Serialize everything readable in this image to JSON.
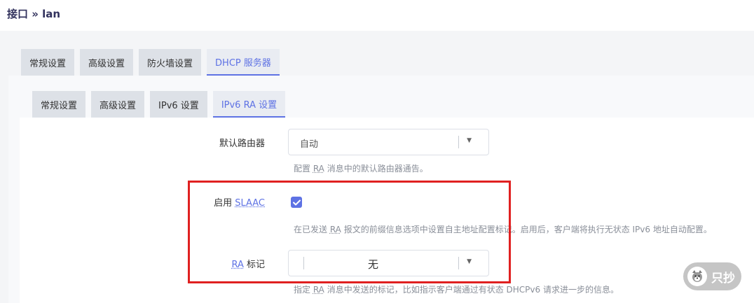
{
  "breadcrumb": "接口 » lan",
  "outer_tabs": [
    {
      "label": "常规设置",
      "active": false
    },
    {
      "label": "高级设置",
      "active": false
    },
    {
      "label": "防火墙设置",
      "active": false
    },
    {
      "label": "DHCP 服务器",
      "active": true
    }
  ],
  "inner_tabs": [
    {
      "label": "常规设置",
      "active": false
    },
    {
      "label": "高级设置",
      "active": false
    },
    {
      "label": "IPv6 设置",
      "active": false
    },
    {
      "label": "IPv6 RA 设置",
      "active": true
    }
  ],
  "default_router": {
    "label": "默认路由器",
    "value": "自动",
    "desc_prefix": "配置 ",
    "desc_abbr": "RA",
    "desc_suffix": " 消息中的默认路由器通告。"
  },
  "slaac": {
    "label_prefix": "启用 ",
    "label_abbr": "SLAAC",
    "checked": true,
    "desc_prefix": "在已发送 ",
    "desc_abbr": "RA",
    "desc_suffix": " 报文的前缀信息选项中设置自主地址配置标记。启用后，客户端将执行无状态 IPv6 地址自动配置。"
  },
  "ra_flags": {
    "label_abbr": "RA",
    "label_suffix": " 标记",
    "value": "无",
    "desc_prefix": "指定 ",
    "desc_abbr": "RA",
    "desc_suffix": " 消息中发送的标记，比如指示客户端通过有状态 DHCPv6 请求进一步的信息。"
  },
  "watermark": "只抄",
  "colors": {
    "accent": "#5e72e4",
    "highlight": "#e02020"
  }
}
